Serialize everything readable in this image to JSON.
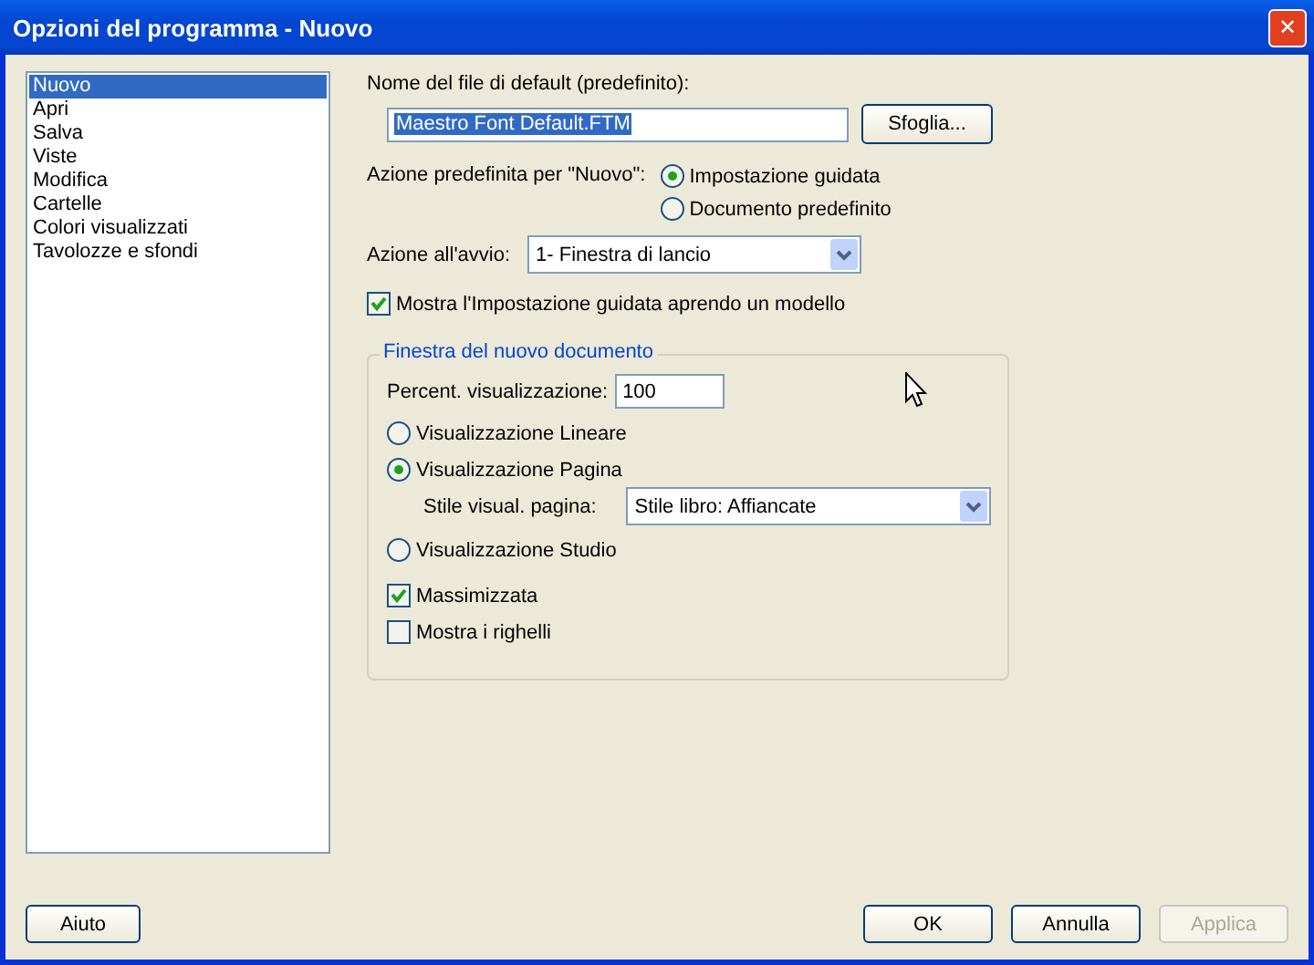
{
  "window": {
    "title": "Opzioni del programma - Nuovo",
    "close": "✕"
  },
  "sidebar": {
    "items": [
      {
        "label": "Nuovo",
        "selected": true
      },
      {
        "label": "Apri",
        "selected": false
      },
      {
        "label": "Salva",
        "selected": false
      },
      {
        "label": "Viste",
        "selected": false
      },
      {
        "label": "Modifica",
        "selected": false
      },
      {
        "label": "Cartelle",
        "selected": false
      },
      {
        "label": "Colori visualizzati",
        "selected": false
      },
      {
        "label": "Tavolozze e sfondi",
        "selected": false
      }
    ]
  },
  "default_file": {
    "label": "Nome del file di default (predefinito):",
    "value": "Maestro Font Default.FTM",
    "browse": "Sfoglia..."
  },
  "new_action": {
    "label": "Azione predefinita per \"Nuovo\":",
    "options": [
      {
        "label": "Impostazione guidata",
        "selected": true
      },
      {
        "label": "Documento predefinito",
        "selected": false
      }
    ]
  },
  "startup": {
    "label": "Azione all'avvio:",
    "value": "1- Finestra di lancio"
  },
  "show_wizard": {
    "label": "Mostra l'Impostazione guidata aprendo un modello",
    "checked": true
  },
  "group": {
    "title": "Finestra del nuovo documento",
    "zoom_label": "Percent. visualizzazione:",
    "zoom_value": "100",
    "views": [
      {
        "label": "Visualizzazione Lineare",
        "selected": false
      },
      {
        "label": "Visualizzazione Pagina",
        "selected": true
      },
      {
        "label": "Visualizzazione Studio",
        "selected": false
      }
    ],
    "page_style": {
      "label": "Stile visual. pagina:",
      "value": "Stile libro: Affiancate"
    },
    "checks": [
      {
        "label": "Massimizzata",
        "checked": true
      },
      {
        "label": "Mostra i righelli",
        "checked": false
      }
    ]
  },
  "buttons": {
    "help": {
      "label": "Aiuto",
      "disabled": false
    },
    "actions": [
      {
        "label": "OK",
        "disabled": false
      },
      {
        "label": "Annulla",
        "disabled": false
      },
      {
        "label": "Applica",
        "disabled": true
      }
    ]
  }
}
